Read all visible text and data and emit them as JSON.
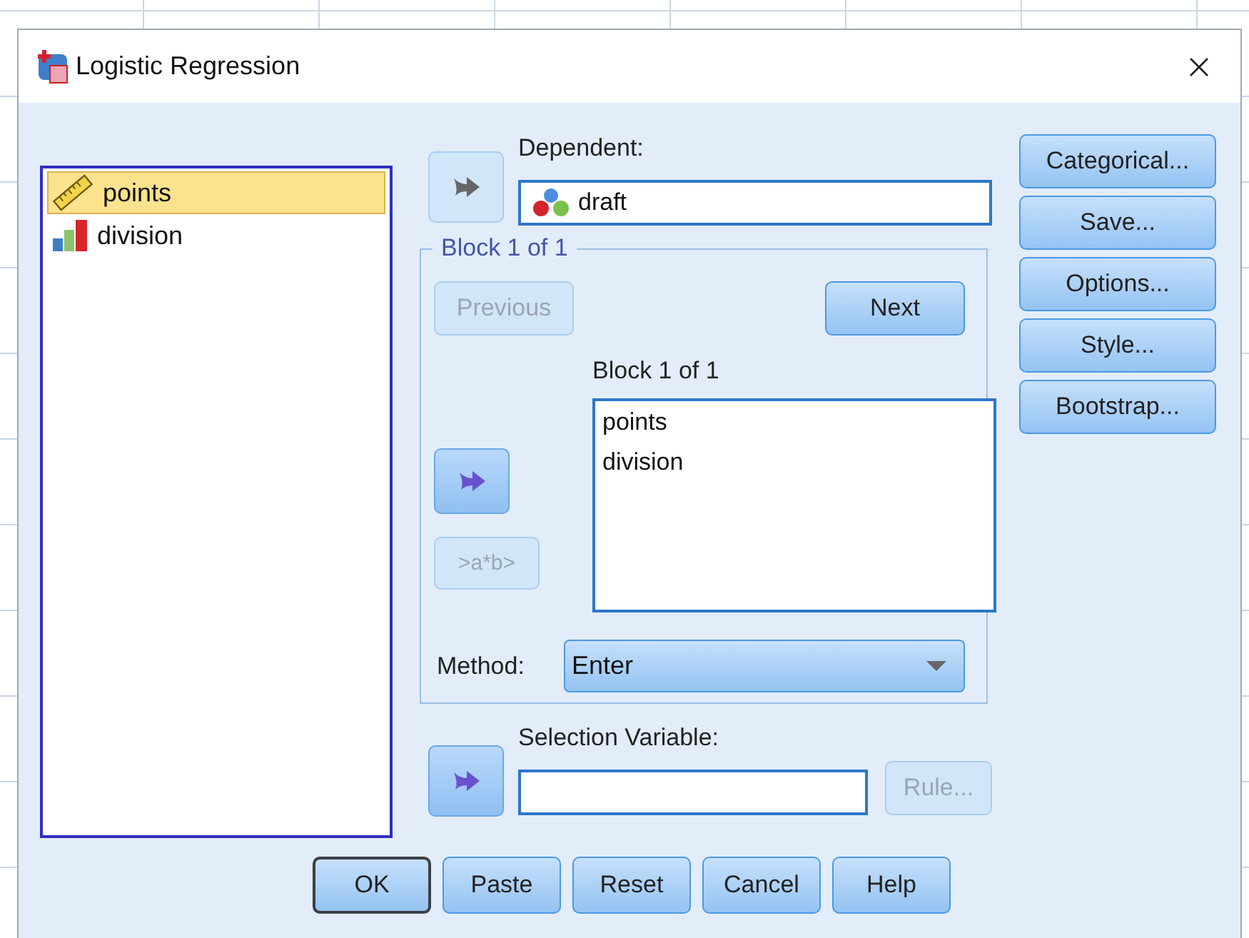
{
  "window": {
    "title": "Logistic Regression"
  },
  "variables": [
    {
      "name": "points",
      "kind": "scale",
      "selected": true
    },
    {
      "name": "division",
      "kind": "ordinal",
      "selected": false
    }
  ],
  "dependent": {
    "label": "Dependent:",
    "value": "draft",
    "kind": "nominal",
    "arrow_disabled": true
  },
  "block": {
    "title": "Block 1 of 1",
    "previous": {
      "label": "Previous",
      "disabled": true
    },
    "next": {
      "label": "Next",
      "disabled": false
    },
    "list_label": "Block 1 of 1",
    "arrow_disabled": false,
    "covariates": [
      "points",
      "division"
    ],
    "interaction": {
      "label": ">a*b>",
      "disabled": true
    }
  },
  "method": {
    "label": "Method:",
    "value": "Enter"
  },
  "selection": {
    "label": "Selection Variable:",
    "arrow_disabled": false,
    "rule": {
      "label": "Rule...",
      "disabled": true
    }
  },
  "side_buttons": [
    "Categorical...",
    "Save...",
    "Options...",
    "Style...",
    "Bootstrap..."
  ],
  "buttons": [
    {
      "label": "OK",
      "default": true
    },
    {
      "label": "Paste",
      "default": false
    },
    {
      "label": "Reset",
      "default": false
    },
    {
      "label": "Cancel",
      "default": false
    },
    {
      "label": "Help",
      "default": false
    }
  ]
}
